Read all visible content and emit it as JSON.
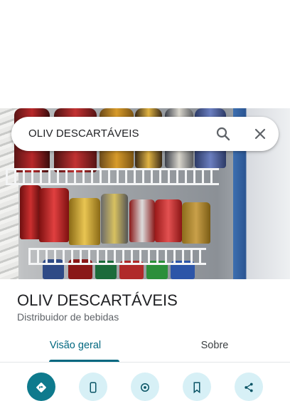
{
  "search": {
    "query": "OLIV DESCARTÁVEIS"
  },
  "place": {
    "name": "OLIV DESCARTÁVEIS",
    "category": "Distribuidor de bebidas"
  },
  "tabs": [
    {
      "label": "Visão geral",
      "active": true
    },
    {
      "label": "Sobre",
      "active": false
    }
  ],
  "actions": [
    {
      "icon": "directions-icon"
    },
    {
      "icon": "phone-icon"
    },
    {
      "icon": "location-icon"
    },
    {
      "icon": "save-icon"
    },
    {
      "icon": "share-icon"
    }
  ],
  "colors": {
    "accent": "#00677f",
    "primary_action": "#0e7a8d",
    "action_tint": "#d7f0f6"
  }
}
